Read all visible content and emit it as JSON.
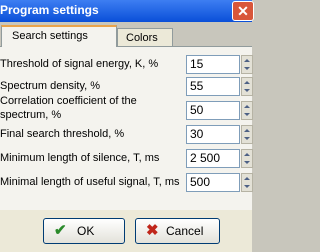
{
  "window": {
    "title": "Program settings",
    "close_glyph": "✕"
  },
  "tabs": [
    {
      "label": "Search settings",
      "active": true
    },
    {
      "label": "Colors",
      "active": false
    }
  ],
  "fields": [
    {
      "label_lines": [
        "Threshold of signal energy, K, %"
      ],
      "value": "15"
    },
    {
      "label_lines": [
        "Spectrum density, %"
      ],
      "value": "55"
    },
    {
      "label_lines": [
        "Correlation coefficient of the",
        "spectrum, %"
      ],
      "value": "50"
    },
    {
      "label_lines": [
        "Final search threshold, %"
      ],
      "value": "30"
    },
    {
      "label_lines": [
        "Minimum length of silence, T, ms"
      ],
      "value": "2 500"
    },
    {
      "label_lines": [
        "Minimal length of useful signal, T, ms"
      ],
      "value": "500"
    }
  ],
  "buttons": {
    "ok": {
      "label": "OK",
      "icon": "checkmark-icon",
      "glyph": "✔"
    },
    "cancel": {
      "label": "Cancel",
      "icon": "cross-icon",
      "glyph": "✖"
    }
  },
  "colors": {
    "titlebar": "#0a4fd8",
    "ok_icon": "#2b8a2b",
    "cancel_icon": "#c0261a"
  }
}
